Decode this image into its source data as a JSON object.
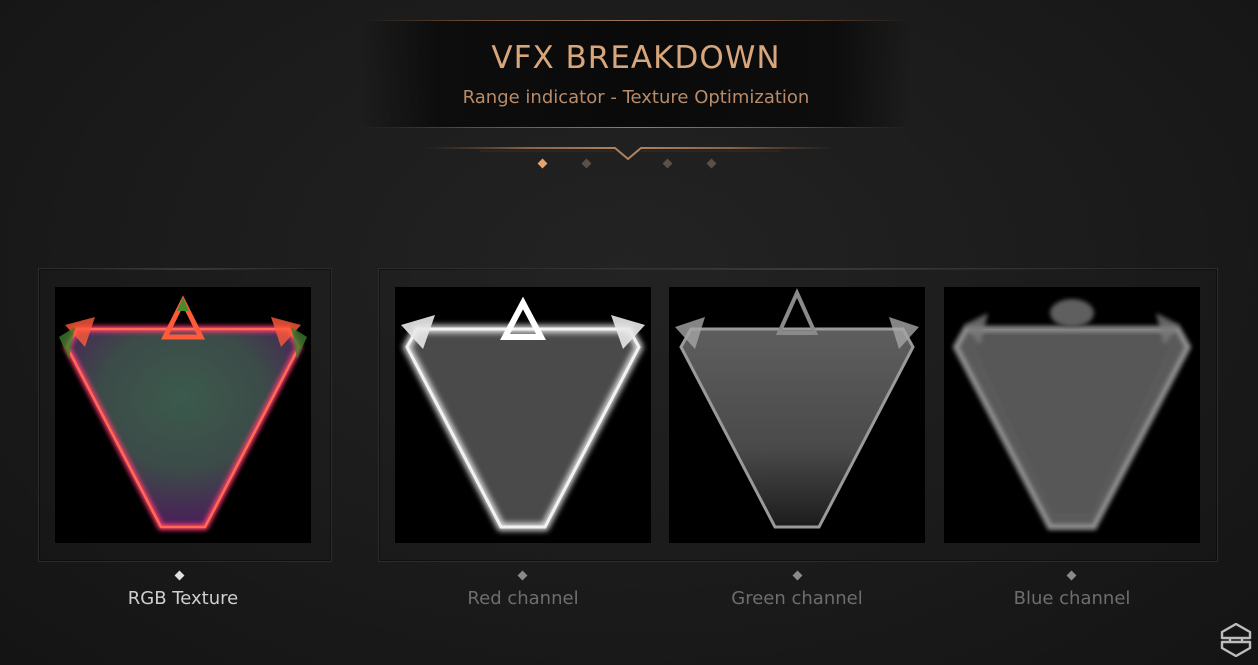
{
  "header": {
    "title": "VFX BREAKDOWN",
    "subtitle": "Range indicator - Texture Optimization"
  },
  "pagination": {
    "active_index": 0,
    "count": 4
  },
  "textures": [
    {
      "label": "RGB Texture",
      "label_color": "#cfcfcf",
      "marker_color": "#e0e0e0"
    },
    {
      "label": "Red channel",
      "label_color": "#6e6e6e",
      "marker_color": "#8a8a8a"
    },
    {
      "label": "Green channel",
      "label_color": "#6e6e6e",
      "marker_color": "#8a8a8a"
    },
    {
      "label": "Blue channel",
      "label_color": "#6e6e6e",
      "marker_color": "#8a8a8a"
    }
  ],
  "colors": {
    "accent": "#d8a67c",
    "subtitle": "#b88c69",
    "pagination_active": "#e3a46e",
    "pagination_inactive": "#5a5048"
  },
  "logo": {
    "icon": "brand-logo-icon"
  }
}
